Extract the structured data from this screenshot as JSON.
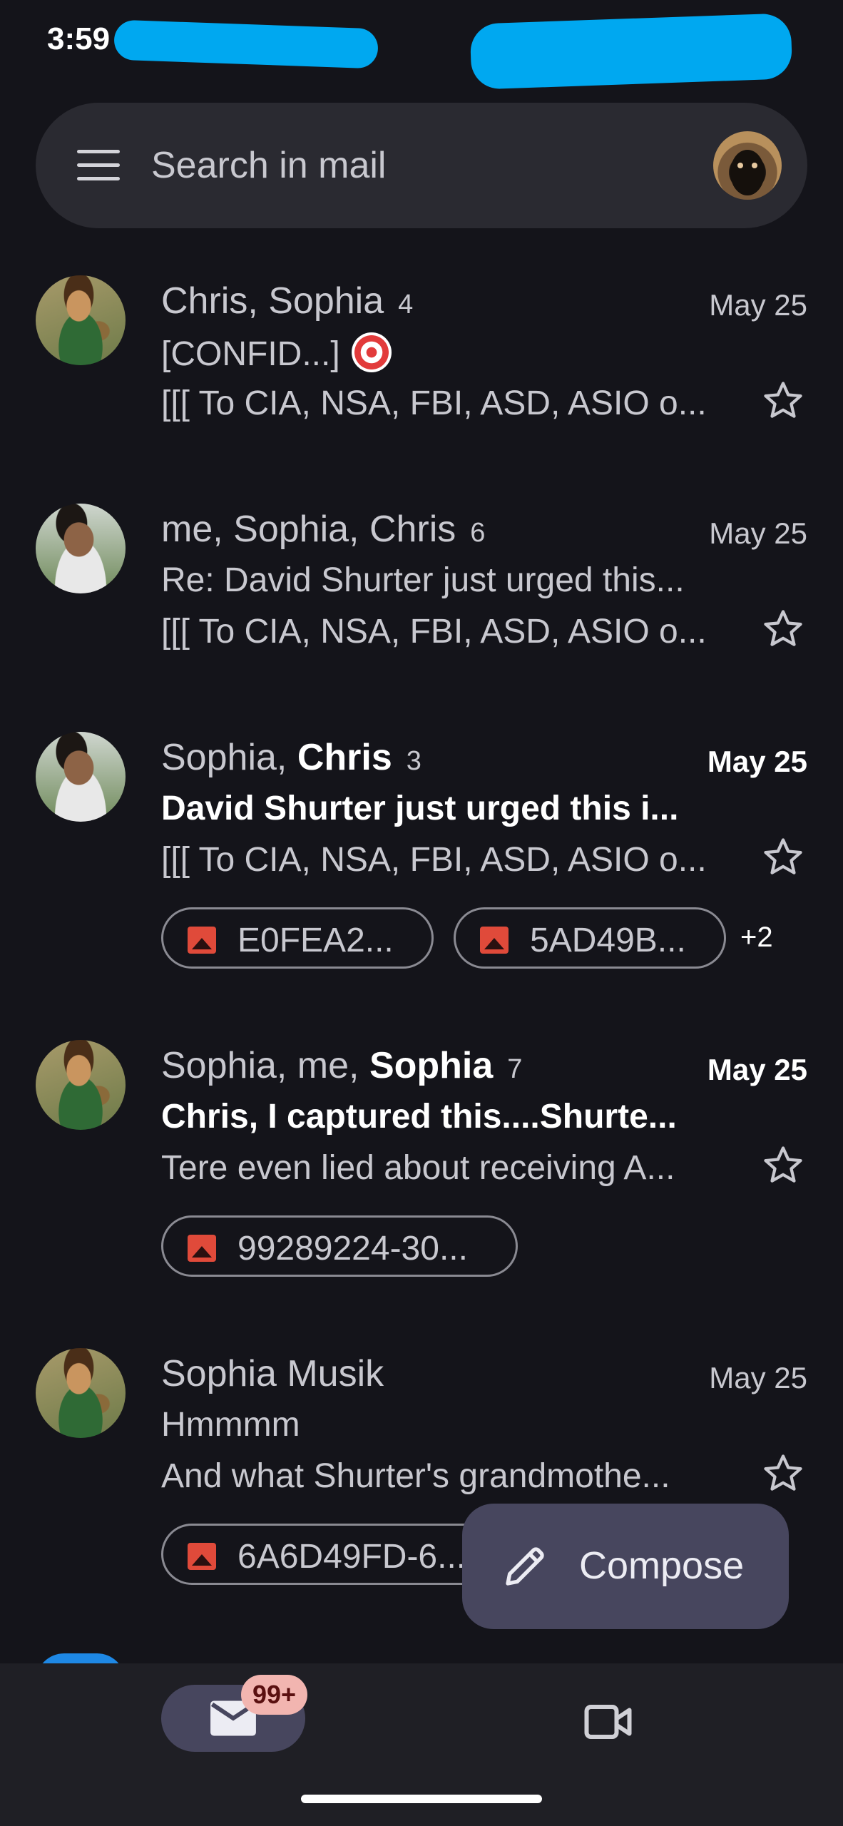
{
  "status_bar": {
    "time": "3:59"
  },
  "search": {
    "placeholder": "Search in mail"
  },
  "emails": [
    {
      "sender_prefix": "Chris, Sophia",
      "sender_bold": "",
      "count": "4",
      "date": "May 25",
      "subject": "[CONFID...]",
      "snippet": "[[[ To CIA, NSA, FBI, ASD, ASIO o...",
      "unread": false,
      "attachments": []
    },
    {
      "sender_prefix": "me, Sophia, Chris",
      "sender_bold": "",
      "count": "6",
      "date": "May 25",
      "subject": "Re: David Shurter just urged this...",
      "snippet": "[[[ To CIA, NSA, FBI, ASD, ASIO o...",
      "unread": false,
      "attachments": []
    },
    {
      "sender_prefix": "Sophia, ",
      "sender_bold": "Chris",
      "count": "3",
      "date": "May 25",
      "subject": "David Shurter just urged this i...",
      "snippet": "[[[ To CIA, NSA, FBI, ASD, ASIO o...",
      "unread": true,
      "attachments": [
        "E0FEA2...",
        "5AD49B..."
      ],
      "more_attachments": "+2"
    },
    {
      "sender_prefix": "Sophia, me, ",
      "sender_bold": "Sophia",
      "count": "7",
      "date": "May 25",
      "subject": "Chris, I captured this....Shurte...",
      "snippet": "Tere even lied about receiving A...",
      "unread": true,
      "attachments": [
        "99289224-30..."
      ]
    },
    {
      "sender_prefix": "Sophia Musik",
      "sender_bold": "",
      "count": "",
      "date": "May 25",
      "subject": "Hmmmm",
      "snippet": "And what Shurter's grandmothe...",
      "unread": false,
      "attachments": [
        "6A6D49FD-6..."
      ]
    }
  ],
  "compose": {
    "label": "Compose"
  },
  "bottom_nav": {
    "mail_badge": "99+"
  },
  "colors": {
    "background": "#14141a",
    "chip_icon": "#e04a3a",
    "fab": "#47465e",
    "badge": "#f2b5b0",
    "redaction": "#00a8f0"
  },
  "icons": [
    "menu-icon",
    "avatar",
    "target-emoji",
    "star-icon",
    "image-icon",
    "pencil-icon",
    "mail-icon",
    "video-icon"
  ]
}
